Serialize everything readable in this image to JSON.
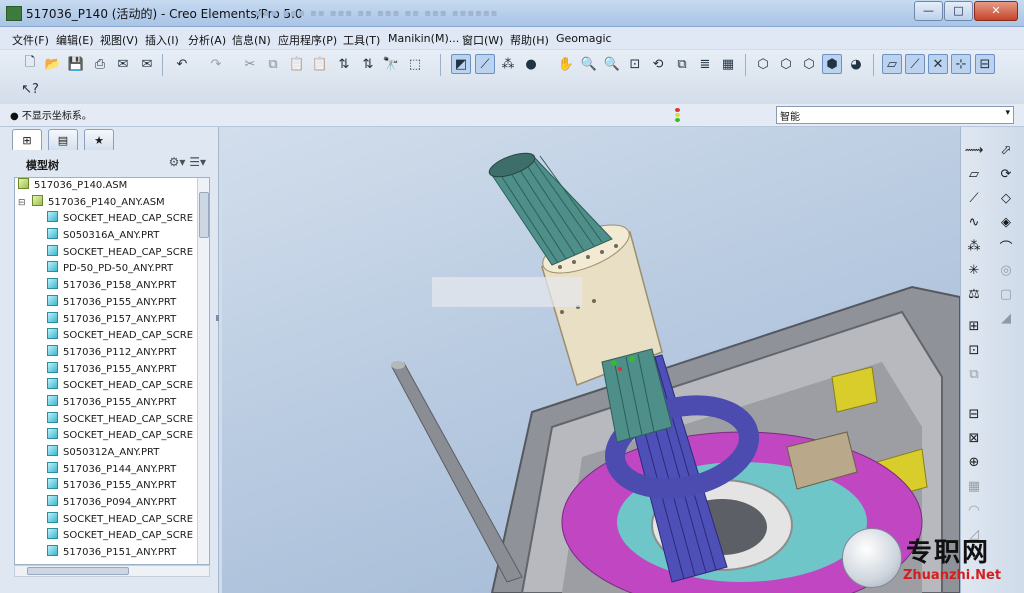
{
  "window": {
    "title": "517036_P140 (活动的) - Creo Elements/Pro 5.0",
    "controls": [
      "—",
      "□",
      "✕"
    ]
  },
  "menu": [
    "文件(F)",
    "编辑(E)",
    "视图(V)",
    "插入(I)",
    "分析(A)",
    "信息(N)",
    "应用程序(P)",
    "工具(T)",
    "Manikin(M)...",
    "窗口(W)",
    "帮助(H)",
    "Geomagic"
  ],
  "status": {
    "message": "不显示坐标系。",
    "filter_value": "智能"
  },
  "model_tree": {
    "header": "模型树",
    "items": [
      {
        "label": "517036_P140.ASM",
        "kind": "asm",
        "level": 0
      },
      {
        "label": "517036_P140_ANY.ASM",
        "kind": "asm",
        "level": 1
      },
      {
        "label": "SOCKET_HEAD_CAP_SCRE",
        "kind": "prt",
        "level": 2
      },
      {
        "label": "S050316A_ANY.PRT",
        "kind": "prt",
        "level": 2
      },
      {
        "label": "SOCKET_HEAD_CAP_SCRE",
        "kind": "prt",
        "level": 2
      },
      {
        "label": "PD-50_PD-50_ANY.PRT",
        "kind": "prt",
        "level": 2
      },
      {
        "label": "517036_P158_ANY.PRT",
        "kind": "prt",
        "level": 2
      },
      {
        "label": "517036_P155_ANY.PRT",
        "kind": "prt",
        "level": 2
      },
      {
        "label": "517036_P157_ANY.PRT",
        "kind": "prt",
        "level": 2
      },
      {
        "label": "SOCKET_HEAD_CAP_SCRE",
        "kind": "prt",
        "level": 2
      },
      {
        "label": "517036_P112_ANY.PRT",
        "kind": "prt",
        "level": 2
      },
      {
        "label": "517036_P155_ANY.PRT",
        "kind": "prt",
        "level": 2
      },
      {
        "label": "SOCKET_HEAD_CAP_SCRE",
        "kind": "prt",
        "level": 2
      },
      {
        "label": "517036_P155_ANY.PRT",
        "kind": "prt",
        "level": 2
      },
      {
        "label": "SOCKET_HEAD_CAP_SCRE",
        "kind": "prt",
        "level": 2
      },
      {
        "label": "SOCKET_HEAD_CAP_SCRE",
        "kind": "prt",
        "level": 2
      },
      {
        "label": "S050312A_ANY.PRT",
        "kind": "prt",
        "level": 2
      },
      {
        "label": "517036_P144_ANY.PRT",
        "kind": "prt",
        "level": 2
      },
      {
        "label": "517036_P155_ANY.PRT",
        "kind": "prt",
        "level": 2
      },
      {
        "label": "517036_P094_ANY.PRT",
        "kind": "prt",
        "level": 2
      },
      {
        "label": "SOCKET_HEAD_CAP_SCRE",
        "kind": "prt",
        "level": 2
      },
      {
        "label": "SOCKET_HEAD_CAP_SCRE",
        "kind": "prt",
        "level": 2
      },
      {
        "label": "517036_P151_ANY.PRT",
        "kind": "prt",
        "level": 2
      }
    ]
  },
  "watermark": {
    "cn": "专职网",
    "url": "Zhuanzhi.Net"
  },
  "colors": {
    "shaft": "#e9dfc4",
    "rods_teal": "#4f8f8a",
    "rods_blue": "#4f4fb8",
    "ring": "#4b4bb0",
    "frame": "#8f9299",
    "magenta": "#c046c2",
    "yellow": "#d8cd2a"
  }
}
